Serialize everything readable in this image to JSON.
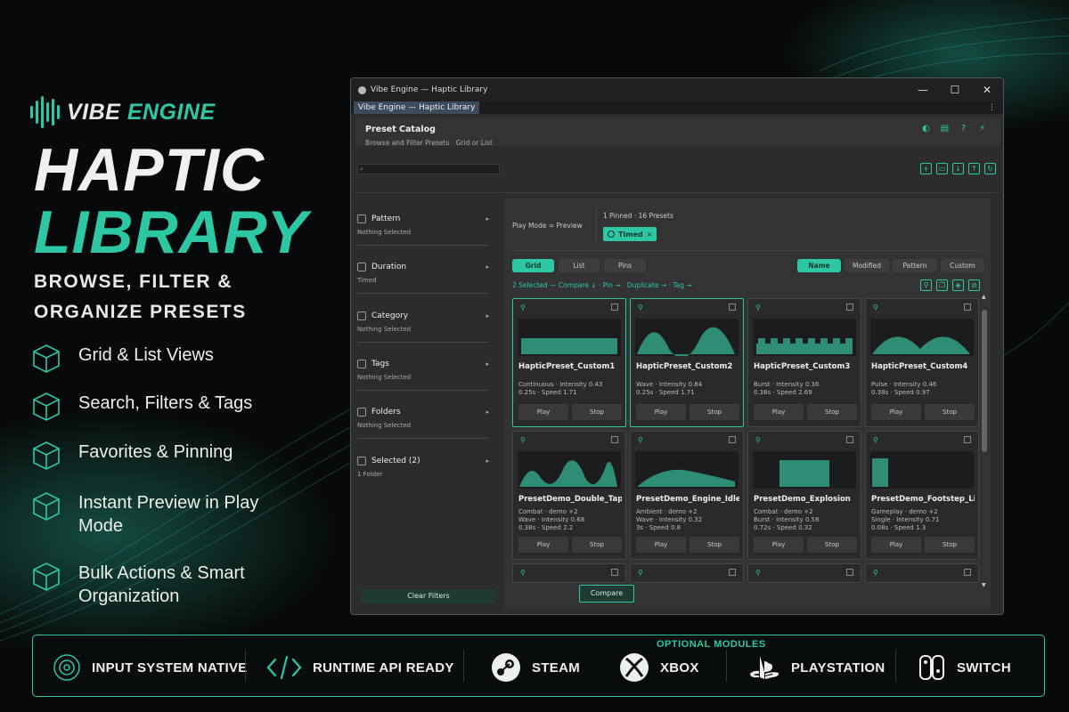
{
  "brand": {
    "name_a": "VIBE",
    "name_b": "ENGINE",
    "accent": "#2ec7a4"
  },
  "hero": {
    "line1": "HAPTIC",
    "line2": "LIBRARY",
    "subtitle": "BROWSE, FILTER & ORGANIZE PRESETS"
  },
  "features": [
    {
      "label": "Grid & List Views"
    },
    {
      "label": "Search, Filters & Tags"
    },
    {
      "label": "Favorites & Pinning"
    },
    {
      "label": "Instant Preview in Play Mode"
    },
    {
      "label": "Bulk Actions & Smart Organization"
    }
  ],
  "window": {
    "title": "Vibe Engine — Haptic Library",
    "tab": "Vibe Engine — Haptic Library",
    "controls": {
      "min": "—",
      "max": "☐",
      "close": "✕"
    },
    "header": {
      "title": "Preset Catalog",
      "subtitle": "Browse and Filter Presets · Grid or List"
    },
    "search_icon": "🔍",
    "filters": [
      {
        "title": "Pattern",
        "status": "Nothing Selected"
      },
      {
        "title": "Duration",
        "status": "Timed"
      },
      {
        "title": "Category",
        "status": "Nothing Selected"
      },
      {
        "title": "Tags",
        "status": "Nothing Selected"
      },
      {
        "title": "Folders",
        "status": "Nothing Selected"
      },
      {
        "title": "Selected (2)",
        "status": "1 Folder"
      }
    ],
    "clear_filters": "Clear Filters",
    "play_mode": "Play Mode = Preview",
    "pinned_count": "1 Pinned · 16 Presets",
    "active_chip": {
      "label": "Timed",
      "x": "×"
    },
    "views": [
      {
        "label": "Grid",
        "active": true
      },
      {
        "label": "List",
        "active": false
      },
      {
        "label": "Pins",
        "active": false
      }
    ],
    "sorts": [
      {
        "label": "Name",
        "active": true
      },
      {
        "label": "Modified",
        "active": false
      },
      {
        "label": "Pattern",
        "active": false
      },
      {
        "label": "Custom",
        "active": false
      }
    ],
    "bulk_actions": "2 Selected — Compare ↓ · Pin → · Duplicate → · Tag →",
    "compare": "Compare",
    "cards": [
      {
        "name": "HapticPreset_Custom1",
        "line1": "Continuous · Intensity 0.43",
        "line2": "0.25s · Speed 1.71",
        "play": "Play",
        "stop": "Stop",
        "selected": true,
        "wave": "continuous"
      },
      {
        "name": "HapticPreset_Custom2",
        "line1": "Wave · Intensity 0.84",
        "line2": "0.25s · Speed 1.71",
        "play": "Play",
        "stop": "Stop",
        "selected": true,
        "wave": "wave"
      },
      {
        "name": "HapticPreset_Custom3",
        "line1": "Burst · Intensity 0.36",
        "line2": "0.38s · Speed 2.69",
        "play": "Play",
        "stop": "Stop",
        "selected": false,
        "wave": "burst"
      },
      {
        "name": "HapticPreset_Custom4",
        "line1": "Pulse · Intensity 0.46",
        "line2": "0.38s · Speed 0.97",
        "play": "Play",
        "stop": "Stop",
        "selected": false,
        "wave": "pulse"
      },
      {
        "name": "PresetDemo_Double_Tap",
        "line1": "Combat · demo +2",
        "line2": "Wave · Intensity 0.68",
        "line3": "0.38s · Speed 2.2",
        "play": "Play",
        "stop": "Stop",
        "selected": false,
        "wave": "wave3"
      },
      {
        "name": "PresetDemo_Engine_Idle",
        "line1": "Ambient · demo +2",
        "line2": "Wave · Intensity 0.32",
        "line3": "3s · Speed 0.8",
        "play": "Play",
        "stop": "Stop",
        "selected": false,
        "wave": "idle"
      },
      {
        "name": "PresetDemo_Explosion",
        "line1": "Combat · demo +2",
        "line2": "Burst · Intensity 0.58",
        "line3": "0.72s · Speed 0.32",
        "play": "Play",
        "stop": "Stop",
        "selected": false,
        "wave": "block"
      },
      {
        "name": "PresetDemo_Footstep_Lig",
        "line1": "Gameplay · demo +2",
        "line2": "Single · Intensity 0.71",
        "line3": "0.08s · Speed 1.3",
        "play": "Play",
        "stop": "Stop",
        "selected": false,
        "wave": "single"
      }
    ]
  },
  "footer": {
    "optional": "OPTIONAL MODULES",
    "items": [
      "INPUT SYSTEM NATIVE",
      "RUNTIME API READY",
      "STEAM",
      "XBOX",
      "PLAYSTATION",
      "SWITCH"
    ]
  }
}
